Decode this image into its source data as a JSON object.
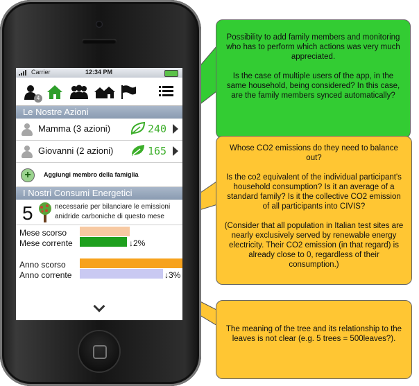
{
  "status_bar": {
    "carrier": "Carrier",
    "time": "12:34 PM"
  },
  "toolbar": {
    "badge_count": "4",
    "icons": [
      "user-icon",
      "home-icon",
      "group-icon",
      "houses-icon",
      "flag-icon",
      "menu-icon"
    ]
  },
  "actions_section": {
    "title": "Le Nostre Azioni",
    "members": [
      {
        "name": "Mamma (3 azioni)",
        "score": "240"
      },
      {
        "name": "Giovanni (2 azioni)",
        "score": "165"
      }
    ],
    "add_label": "Aggiungi membro della famiglia"
  },
  "consumption_section": {
    "title": "I Nostri Consumi Energetici",
    "tree_count": "5",
    "tree_desc": "necessarie per bilanciare le emissioni anidride carboniche di questo mese",
    "month": {
      "label_prev": "Mese scorso",
      "label_curr": "Mese corrente",
      "change": "↓2%"
    },
    "year": {
      "label_prev": "Anno scorso",
      "label_curr": "Anno corrente",
      "change": "↓3%"
    }
  },
  "callouts": {
    "green": {
      "p1": "Possibility to add family members and monitoring who has to perform which actions was very much appreciated.",
      "p2": "Is the case of multiple users of the app, in the same household, being considered? In this case, are the family members synced automatically?"
    },
    "orange_top": {
      "p1": "Whose CO2 emissions do they need to balance out?",
      "p2": "Is the co2 equivalent of the individual participant's household consumption? Is it an average of a standard family? Is it the collective CO2 emission of all participants into CIVIS?",
      "p3": "(Consider that all population in Italian test sites are nearly exclusively served by renewable energy electricity. Their CO2 emission (in that regard) is already close to 0, regardless of their consumption.)"
    },
    "orange_bottom": {
      "p1": "The meaning of the tree and its relationship to the leaves is not clear (e.g. 5 trees = 500leaves?)."
    }
  },
  "colors": {
    "green_callout": "#33cc33",
    "orange_callout": "#ffc633",
    "score_green": "#3cae2a",
    "section_header": "#9aa9bd"
  }
}
